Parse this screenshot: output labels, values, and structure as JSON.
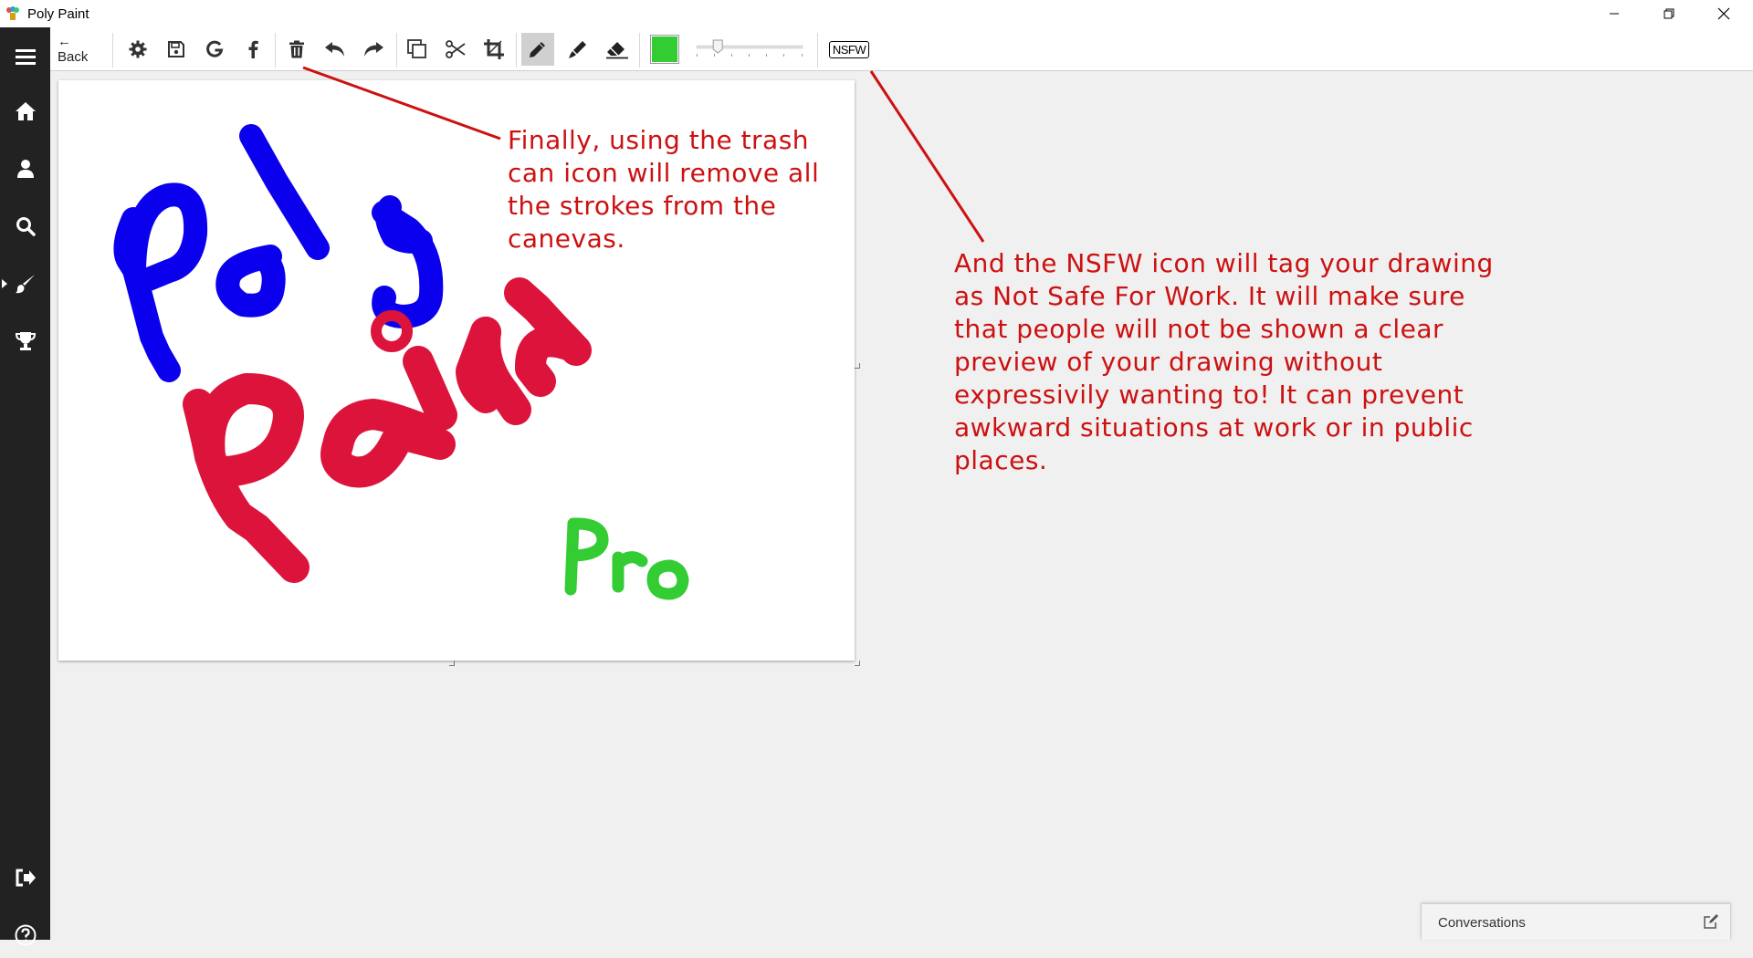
{
  "window": {
    "title": "Poly Paint",
    "minimize_glyph": "—",
    "maximize_glyph": "❐",
    "close_glyph": "✕"
  },
  "sidebar": {
    "items": [
      {
        "icon": "menu-icon"
      },
      {
        "icon": "home-icon"
      },
      {
        "icon": "user-icon"
      },
      {
        "icon": "search-icon"
      },
      {
        "icon": "paintbrush-icon"
      },
      {
        "icon": "trophy-icon"
      },
      {
        "icon": "sign-out-icon"
      },
      {
        "icon": "help-icon"
      }
    ]
  },
  "toolbar": {
    "back_label": "← Back",
    "nsfw_label": "NSFW",
    "color": "#33cc33",
    "thickness_slider_value": 0.2
  },
  "annotations": {
    "trash": "Finally, using the trash can icon will remove all the strokes from the canevas.",
    "nsfw": "And the NSFW icon will tag your drawing as Not Safe For Work. It will make sure that people will not be shown a clear preview of your drawing without expressivily wanting to! It can prevent awkward situations at work or in public places."
  },
  "canvas": {
    "strokes": [
      {
        "text": "Poly",
        "color": "#0a00ee"
      },
      {
        "text": "Pain",
        "color": "#dc143c"
      },
      {
        "text": "Pro",
        "color": "#33cc33"
      }
    ]
  },
  "conversations": {
    "label": "Conversations"
  },
  "colors": {
    "annotation_red": "#cc1111",
    "sidebar_bg": "#222222",
    "active_tool_bg": "#d0d0d0"
  }
}
